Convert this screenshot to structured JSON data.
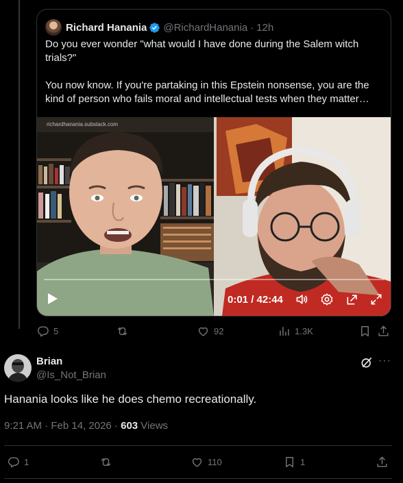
{
  "quoted_post": {
    "author_name": "Richard Hanania",
    "handle": "@RichardHanania",
    "separator": "·",
    "time": "12h",
    "text_line1": "Do you ever wonder \"what would I have done during the Salem witch trials?\"",
    "text_line2": "You now know. If you're partaking in this Epstein nonsense, you are the kind of person who fails moral and intellectual tests when they matter…",
    "video": {
      "url_overlay": "richardhanania.substack.com",
      "time": "0:01 / 42:44",
      "progress_fraction": 0.0
    },
    "actions": {
      "replies": "5",
      "reposts": "",
      "likes": "92",
      "views": "1.3K"
    }
  },
  "reply_post": {
    "author_name": "Brian",
    "handle": "@Is_Not_Brian",
    "more": "···",
    "text": "Hanania looks like he does chemo recreationally.",
    "meta_time": "9:21 AM · Feb 14, 2026 · ",
    "views_count": "603",
    "views_label": " Views",
    "actions": {
      "replies": "1",
      "reposts": "",
      "likes": "110",
      "bookmarks": "1"
    }
  },
  "colors": {
    "background": "#000000",
    "text": "#e7e9ea",
    "muted": "#71767b",
    "border": "#2f3336",
    "verified": "#1d9bf0"
  },
  "icons": [
    "verified-badge-icon",
    "play-icon",
    "volume-icon",
    "settings-icon",
    "popout-icon",
    "fullscreen-icon",
    "reply-icon",
    "repost-icon",
    "like-icon",
    "views-icon",
    "bookmark-icon",
    "share-icon",
    "grok-icon",
    "more-icon"
  ]
}
